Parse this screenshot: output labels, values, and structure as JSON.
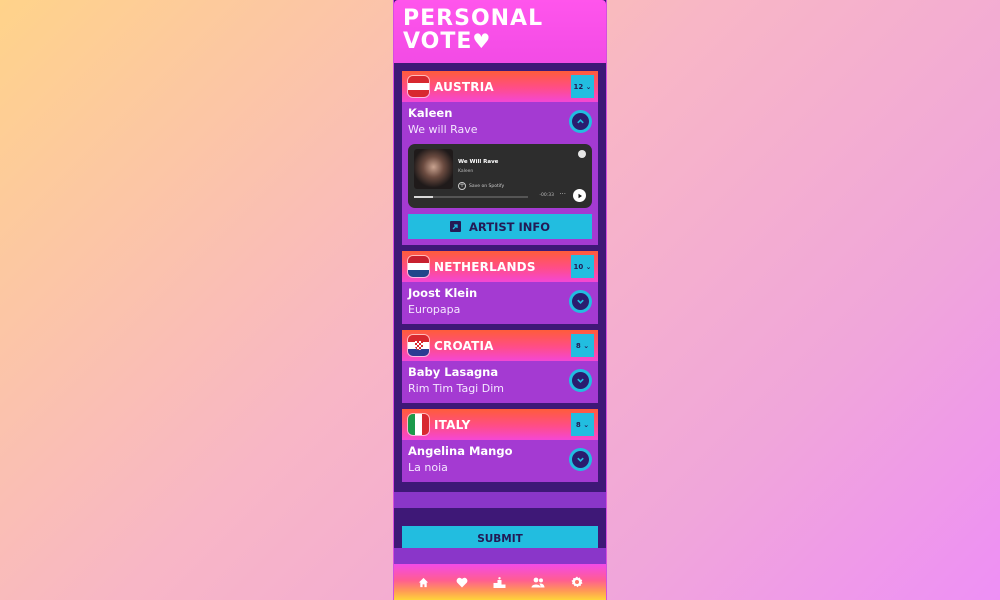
{
  "app": {
    "title": "PERSONAL VOTE",
    "title_line1": "PERSONAL",
    "title_line2": "VOTE",
    "heart": "♥"
  },
  "entries": [
    {
      "country": "AUSTRIA",
      "flag": "austria-flag",
      "points": "12 ⌄",
      "artist": "Kaleen",
      "song": "We will Rave",
      "expanded": true,
      "toggle_icon": "chevron-up-icon",
      "player": {
        "track": "We Will Rave",
        "artist": "Kaleen",
        "save_label": "Save on Spotify",
        "time": "-00:33",
        "more": "···",
        "progress": 0.17
      },
      "artist_info_label": "ARTIST INFO"
    },
    {
      "country": "NETHERLANDS",
      "flag": "netherlands-flag",
      "points": "10 ⌄",
      "artist": "Joost Klein",
      "song": "Europapa",
      "expanded": false,
      "toggle_icon": "chevron-down-icon"
    },
    {
      "country": "CROATIA",
      "flag": "croatia-flag",
      "points": "8 ⌄",
      "artist": "Baby Lasagna",
      "song": "Rim Tim Tagi Dim",
      "expanded": false,
      "toggle_icon": "chevron-down-icon"
    },
    {
      "country": "ITALY",
      "flag": "italy-flag",
      "points": "8 ⌄",
      "artist": "Angelina Mango",
      "song": "La noia",
      "expanded": false,
      "toggle_icon": "chevron-down-icon"
    }
  ],
  "submit_label": "SUBMIT",
  "nav": [
    "home-icon",
    "heart-icon",
    "podium-icon",
    "users-icon",
    "settings-icon"
  ],
  "colors": {
    "accent": "#22bde0",
    "dark": "#3e1877",
    "card": "#a43ad2",
    "header": "#f24be5",
    "text_dark": "#241a55"
  }
}
